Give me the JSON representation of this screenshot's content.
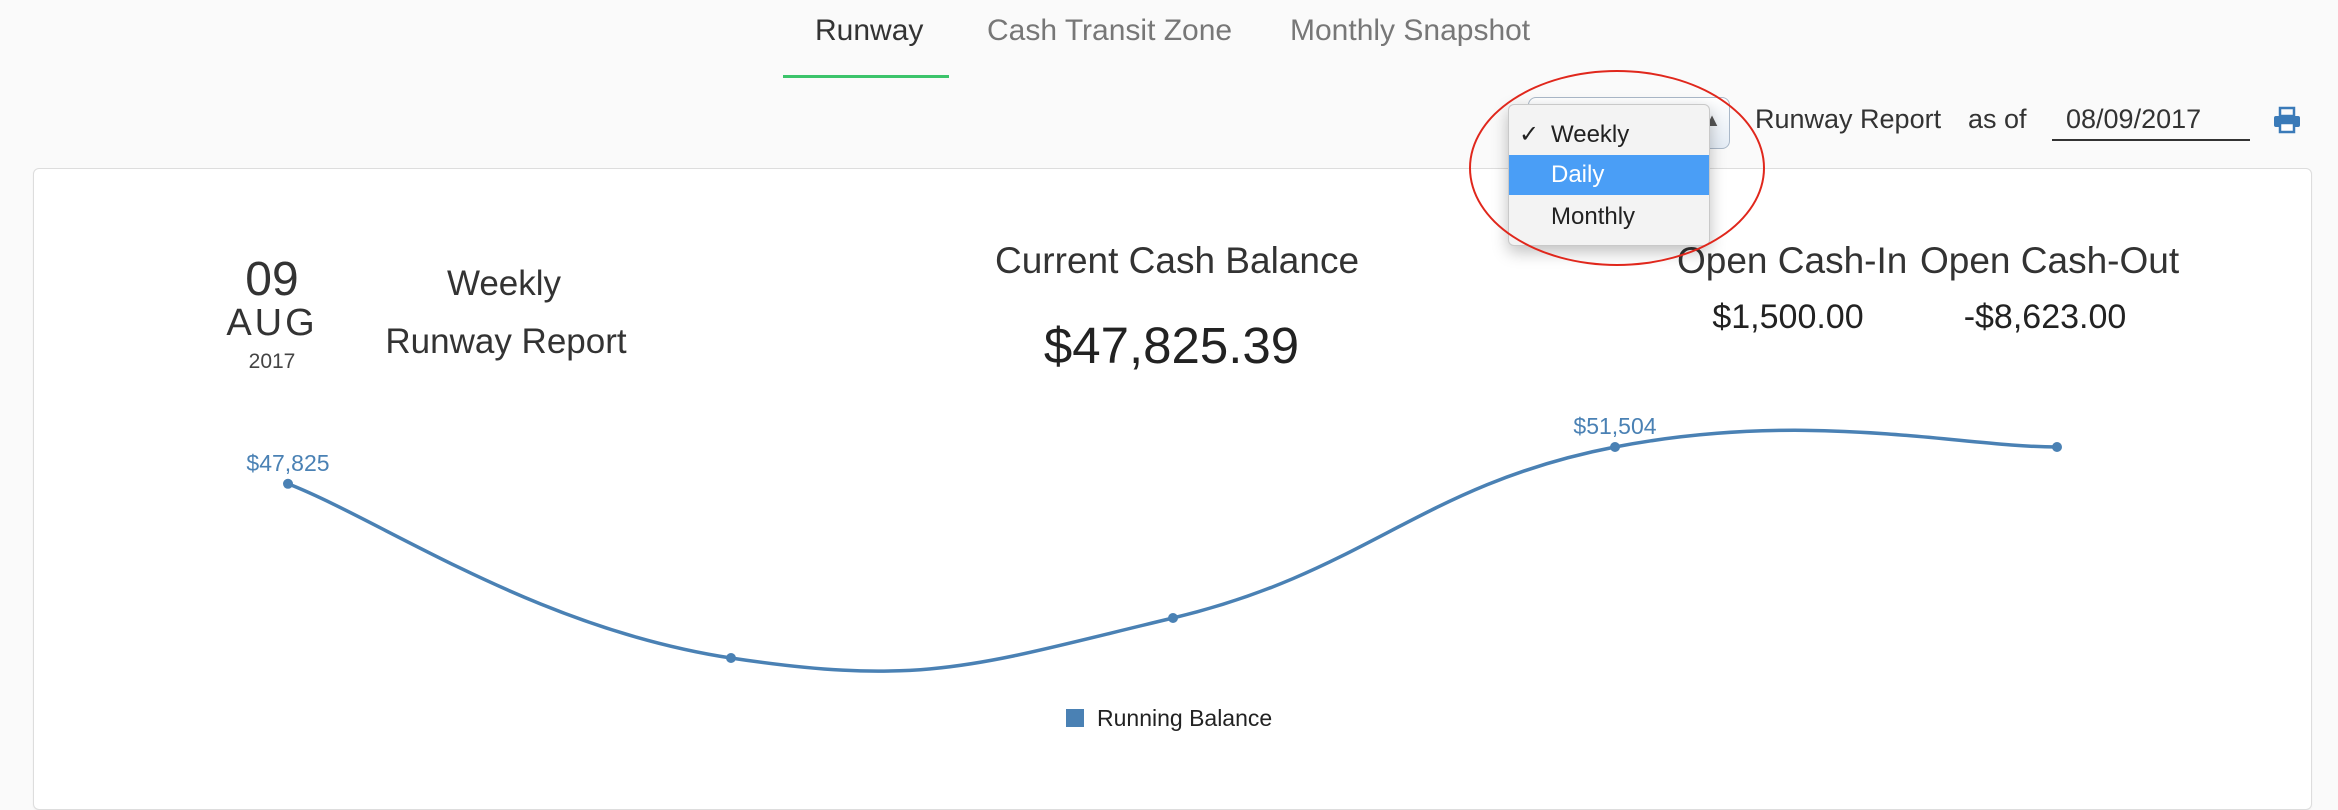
{
  "tabs": [
    {
      "label": "Runway",
      "active": true
    },
    {
      "label": "Cash Transit Zone",
      "active": false
    },
    {
      "label": "Monthly Snapshot",
      "active": false
    }
  ],
  "toolbar": {
    "report_label": "Runway Report",
    "as_of_label": "as of",
    "date_value": "08/09/2017",
    "print_icon": "print-icon"
  },
  "period_dropdown": {
    "options": [
      "Weekly",
      "Daily",
      "Monthly"
    ],
    "checked": "Weekly",
    "highlighted": "Daily"
  },
  "summary": {
    "day": "09",
    "month": "AUG",
    "year": "2017",
    "report_line1": "Weekly",
    "report_line2": "Runway Report",
    "current_cash_label": "Current Cash Balance",
    "current_cash_value": "$47,825.39",
    "open_cash_in_label": "Open Cash-In",
    "open_cash_in_value": "$1,500.00",
    "open_cash_out_label": "Open Cash-Out",
    "open_cash_out_value": "-$8,623.00"
  },
  "colors": {
    "accent": "#3cc46b",
    "line": "#4a81b4",
    "highlight": "#4a9ef6",
    "annotation": "#e0271c"
  },
  "chart_data": {
    "type": "line",
    "series": [
      {
        "name": "Running Balance",
        "values": [
          47825,
          30400,
          34400,
          51504,
          51504
        ],
        "point_labels": [
          "$47,825",
          "",
          "",
          "$51,504",
          ""
        ]
      }
    ],
    "legend_position": "bottom-center",
    "grid": false
  }
}
